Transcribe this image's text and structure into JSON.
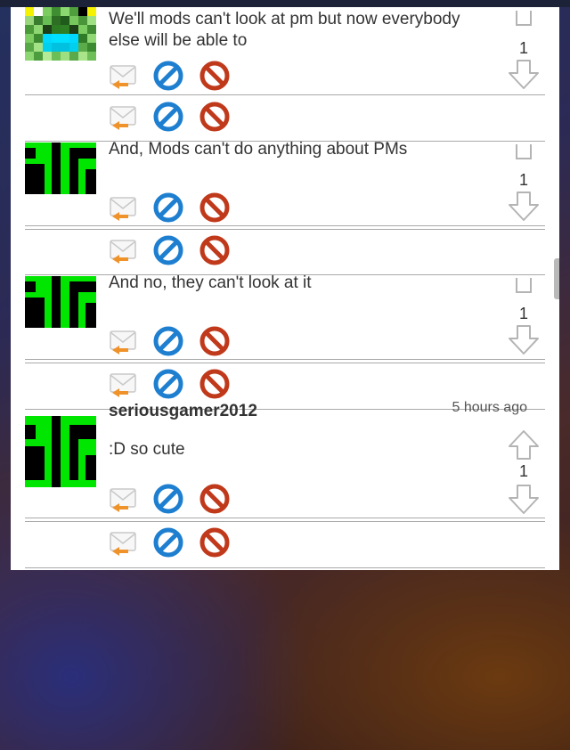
{
  "comments": [
    {
      "id": "c1",
      "text": "We'll mods can't look at pm but now everybody else will be able to",
      "votes": "1",
      "avatar": "minecraft-creeper-avatar"
    },
    {
      "id": "c2",
      "text": "And, Mods can't do anything about PMs",
      "votes": "1",
      "avatar": "sg-logo-avatar"
    },
    {
      "id": "c3",
      "text": "And no, they can't look at it",
      "votes": "1",
      "avatar": "sg-logo-avatar"
    },
    {
      "id": "c4",
      "author": "seriousgamer2012",
      "time": "5 hours ago",
      "text": ":D so cute",
      "votes": "1",
      "avatar": "sg-logo-avatar"
    }
  ],
  "icons": {
    "reply": "reply-envelope-icon",
    "flag": "flag-icon",
    "block": "block-icon",
    "upvote": "upvote-arrow-icon",
    "downvote": "downvote-arrow-icon"
  },
  "colors": {
    "sg_green": "#00e600",
    "flag_blue": "#1e7fd0",
    "block_red": "#c0391b",
    "reply_orange": "#f0922a"
  }
}
